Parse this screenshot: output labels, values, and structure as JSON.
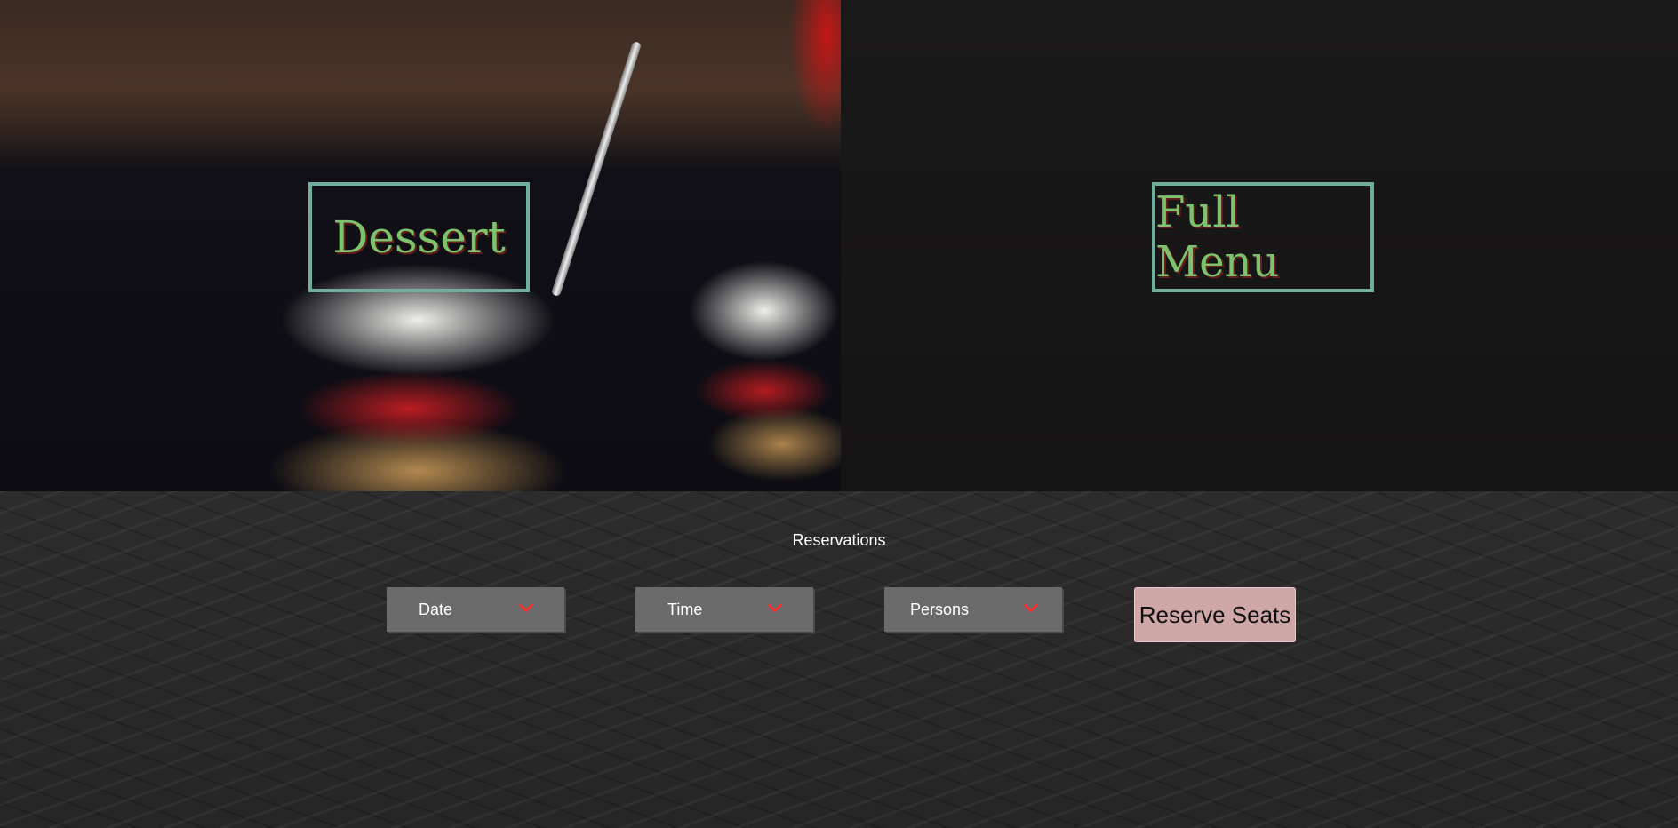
{
  "hero": {
    "tiles": [
      {
        "label": "Dessert"
      },
      {
        "label": "Full Menu"
      }
    ]
  },
  "reservations": {
    "title": "Reservations",
    "date_label": "Date",
    "time_label": "Time",
    "persons_label": "Persons",
    "reserve_label": "Reserve Seats"
  },
  "colors": {
    "menu_border": "#6fae9a",
    "menu_text": "#7dc36e",
    "dropdown_bg": "#6b6b6b",
    "chevron": "#ff2a2a",
    "reserve_bg": "#cfa7a7"
  },
  "icons": {
    "dropdown": "chevron-down-icon"
  }
}
